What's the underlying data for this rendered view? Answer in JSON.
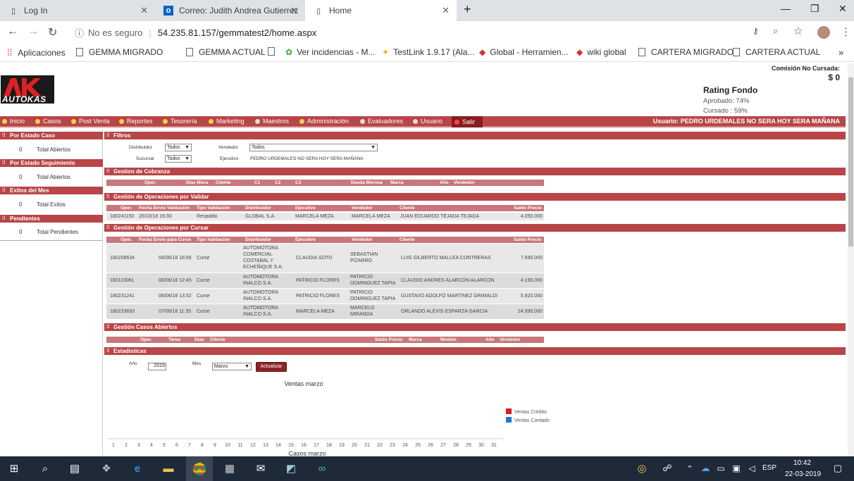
{
  "browser": {
    "tabs": [
      {
        "title": "Log In",
        "icon": "page-icon"
      },
      {
        "title": "Correo: Judith Andrea Gutierrez",
        "icon": "outlook-icon"
      },
      {
        "title": "Home",
        "icon": "page-icon"
      }
    ],
    "url_warning": "No es seguro",
    "url": "54.235.81.157/gemmatest2/home.aspx",
    "bookmarks": [
      "Aplicaciones",
      "GEMMA MIGRADO",
      "GEMMA ACTUAL",
      "Ver incidencias - M...",
      "TestLink 1.9.17 (Ala...",
      "Global - Herramien...",
      "wiki global",
      "CARTERA MIGRADO",
      "CARTERA ACTUAL"
    ]
  },
  "header": {
    "logo_text": "AUTOKAS",
    "comision_label": "Comisión No Cursada:",
    "comision_value": "$ 0",
    "rating_title": "Rating Fondo",
    "aprobado": "Aprobado: 74%",
    "cursado": "Cursado : 59%"
  },
  "menu": {
    "items": [
      "Inicio",
      "Casos",
      "Post Venta",
      "Reportes",
      "Tesorería",
      "Marketing",
      "Maestros",
      "Administración",
      "Evaluadores",
      "Usuario",
      "Salir"
    ],
    "usuario": "Usuario:  PEDRO URDEMALES NO SERA HOY SERA MAÑANA"
  },
  "sidebar": [
    {
      "header": "Por Estado Caso",
      "count": "0",
      "label": "Total Abiertos"
    },
    {
      "header": "Por Estado Seguimiento",
      "count": "0",
      "label": "Total Abiertos"
    },
    {
      "header": "Exitos del Mes",
      "count": "0",
      "label": "Total Exitos"
    },
    {
      "header": "Pendientes",
      "count": "0",
      "label": "Total Pendientes"
    }
  ],
  "filtros": {
    "title": "Filtros",
    "distribuidor_label": "Distribuidor",
    "distribuidor_value": "Todos",
    "vendedor_label": "Vendedor",
    "vendedor_value": "Todos",
    "sucursal_label": "Sucursal",
    "sucursal_value": "Todos",
    "ejecutivo_label": "Ejecutivo",
    "ejecutivo_value": "PEDRO URDEMALES NO SERA HOY SERA MAÑANA"
  },
  "cobranza": {
    "title": "Gestion de Cobranza",
    "columns": [
      "Oper.",
      "Dias Mora",
      "Cliente",
      "C1",
      "C2",
      "C3",
      "Deuda Morosa",
      "Marca",
      "Año",
      "Vendedor"
    ]
  },
  "validar": {
    "title": "Gestión de Operaciones por Validar",
    "columns": [
      "Oper.",
      "Fecha Envio Validación",
      "Tipo Validación",
      "Distribuidor",
      "Ejecutivo",
      "Vendedor",
      "Cliente",
      "Saldo Precio"
    ],
    "rows": [
      [
        "180241150",
        "26/10/18 16:30",
        "Respaldo",
        "GLOBAL S.A.",
        "MARCELA MEZA",
        "MARCELA MEZA",
        "JUAN EDUARDO TEJADA TEJADA",
        "4.050.000"
      ]
    ]
  },
  "cursar": {
    "title": "Gestión de Operaciones por Cursar",
    "columns": [
      "Oper.",
      "Fecha Envio para Curse",
      "Tipo Validación",
      "Distribuidor",
      "Ejecutivo",
      "Vendedor",
      "Cliente",
      "Saldo Precio"
    ],
    "rows": [
      [
        "180208634",
        "04/06/18 16:56",
        "Curse",
        "AUTOMOTORA COMERCIAL COSTABAL Y ECHEÑIQUE S.A.",
        "CLAUDIA SOTO",
        "SEBASTIAN PIZARRO",
        "LUIS GILBERTO MALLEA CONTRERAS",
        "7.690.000"
      ],
      [
        "160110061",
        "08/06/18 12:45",
        "Curse",
        "AUTOMOTORA INALCO S.A.",
        "PATRICIO FLORES",
        "PATRICIO DOMINGUEZ TAPIA",
        "CLAUDIO ANDRES ALARCON ALARCON",
        "4.190.000"
      ],
      [
        "180231241",
        "08/06/18 13:32",
        "Curse",
        "AUTOMOTORA INALCO S.A.",
        "PATRICIO FLORES",
        "PATRICIO DOMINGUEZ TAPIA",
        "GUSTAVO ADOLFO MARTINEZ GRIMALDI",
        "5.920.000"
      ],
      [
        "180233693",
        "07/09/18 11:35",
        "Curse",
        "AUTOMOTORA INALCO S.A.",
        "MARCELA MEZA",
        "MARCELO MIRANDA",
        "ORLANDO ALEXIS ESPARZA GARCIA",
        "24.990.000"
      ]
    ]
  },
  "abiertos": {
    "title": "Gestión Casos Abiertos",
    "columns": [
      "Oper.",
      "Tarea",
      "Dias",
      "Cliente",
      "Saldo Precio",
      "Marca",
      "Modelo",
      "Año",
      "Vendedor"
    ]
  },
  "estadisticas": {
    "title": "Estadísticas",
    "anio_label": "Año",
    "anio_value": "2019",
    "mes_label": "Mes",
    "mes_value": "Marzo",
    "button": "Actualizar"
  },
  "chart_data": {
    "type": "bar",
    "title": "Ventas marzo",
    "xlabel": "Casos marzo",
    "categories": [
      "1",
      "2",
      "3",
      "4",
      "5",
      "6",
      "7",
      "8",
      "9",
      "10",
      "11",
      "12",
      "13",
      "14",
      "15",
      "16",
      "17",
      "18",
      "19",
      "20",
      "21",
      "22",
      "23",
      "24",
      "25",
      "26",
      "27",
      "28",
      "29",
      "30",
      "31"
    ],
    "series": [
      {
        "name": "Ventas Crédito",
        "color": "#e31a1c",
        "values": [
          0,
          0,
          0,
          0,
          0,
          0,
          0,
          0,
          0,
          0,
          0,
          0,
          0,
          0,
          0,
          0,
          0,
          0,
          0,
          0,
          0,
          0,
          0,
          0,
          0,
          0,
          0,
          0,
          0,
          0,
          0
        ]
      },
      {
        "name": "Ventas Contado",
        "color": "#1f78d1",
        "values": [
          0,
          0,
          0,
          0,
          0,
          0,
          0,
          0,
          0,
          0,
          0,
          0,
          0,
          0,
          0,
          0,
          0,
          0,
          0,
          0,
          0,
          0,
          0,
          0,
          0,
          0,
          0,
          0,
          0,
          0,
          0
        ]
      }
    ],
    "legend": "right"
  },
  "taskbar": {
    "lang": "ESP",
    "time": "10:42",
    "date": "22-03-2019"
  }
}
